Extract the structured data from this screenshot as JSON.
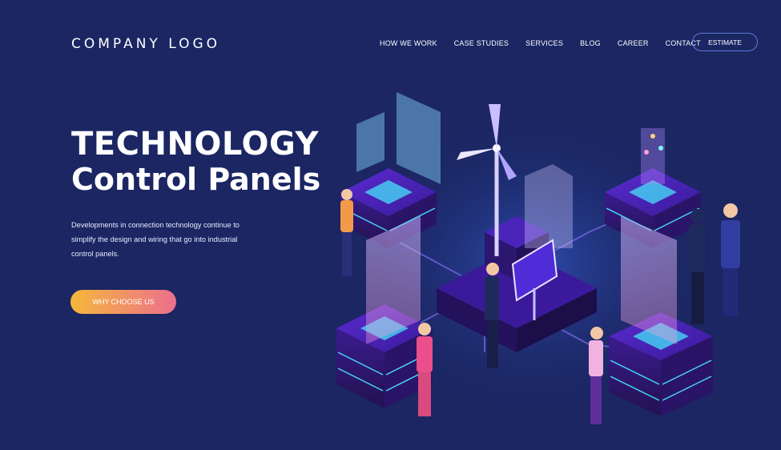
{
  "header": {
    "logo": "COMPANY LOGO",
    "nav": [
      "HOW WE WORK",
      "CASE STUDIES",
      "SERVICES",
      "BLOG",
      "CAREER",
      "CONTACT"
    ],
    "estimate_label": "ESTIMATE"
  },
  "hero": {
    "title_line1": "TECHNOLOGY",
    "title_line2": "Control Panels",
    "description": "Developments in connection technology continue to simplify the design and wiring that go into industrial control panels.",
    "cta_label": "WHY CHOOSE US"
  },
  "colors": {
    "background": "#1b2663",
    "cta_start": "#f5b73a",
    "cta_end": "#ec6f8e",
    "accent_cyan": "#46d6f5",
    "accent_purple": "#6a2fd0"
  },
  "illustration": {
    "icons": [
      "isometric-server-stack",
      "wind-turbine",
      "solar-panel",
      "hologram-screen",
      "people-figures"
    ]
  }
}
